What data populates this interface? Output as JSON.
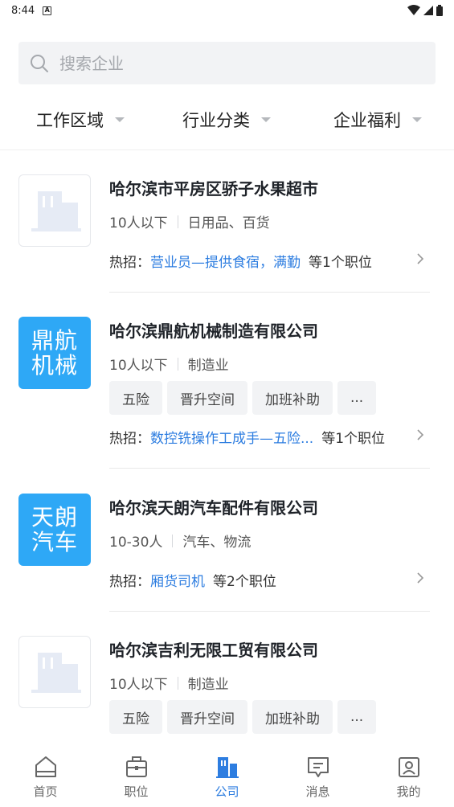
{
  "status_bar": {
    "time": "8:44"
  },
  "search": {
    "placeholder": "搜索企业"
  },
  "filters": [
    {
      "label": "工作区域"
    },
    {
      "label": "行业分类"
    },
    {
      "label": "企业福利"
    }
  ],
  "companies": [
    {
      "name": "哈尔滨市平房区骄子水果超市",
      "size": "10人以下",
      "industry": "日用品、百货",
      "hot_prefix": "热招：",
      "hot_job": "营业员—提供食宿，满勤",
      "hot_count": "等1个职位"
    },
    {
      "name": "哈尔滨鼎航机械制造有限公司",
      "logo_text": "鼎航机械",
      "size": "10人以下",
      "industry": "制造业",
      "tags": [
        "五险",
        "晋升空间",
        "加班补助",
        "..."
      ],
      "hot_prefix": "热招：",
      "hot_job": "数控铣操作工成手—五险...",
      "hot_count": "等1个职位"
    },
    {
      "name": "哈尔滨天朗汽车配件有限公司",
      "logo_text": "天朗汽车",
      "size": "10-30人",
      "industry": "汽车、物流",
      "hot_prefix": "热招：",
      "hot_job": "厢货司机",
      "hot_count": "等2个职位"
    },
    {
      "name": "哈尔滨吉利无限工贸有限公司",
      "size": "10人以下",
      "industry": "制造业",
      "tags": [
        "五险",
        "晋升空间",
        "加班补助",
        "..."
      ]
    }
  ],
  "tabbar": [
    {
      "label": "首页",
      "icon": "home-icon"
    },
    {
      "label": "职位",
      "icon": "briefcase-icon"
    },
    {
      "label": "公司",
      "icon": "building-icon",
      "active": true
    },
    {
      "label": "消息",
      "icon": "message-icon"
    },
    {
      "label": "我的",
      "icon": "profile-icon"
    }
  ],
  "colors": {
    "accent": "#2d7de0",
    "logo_bg": "#2ea8f6",
    "placeholder_building": "#e6ebf5"
  }
}
